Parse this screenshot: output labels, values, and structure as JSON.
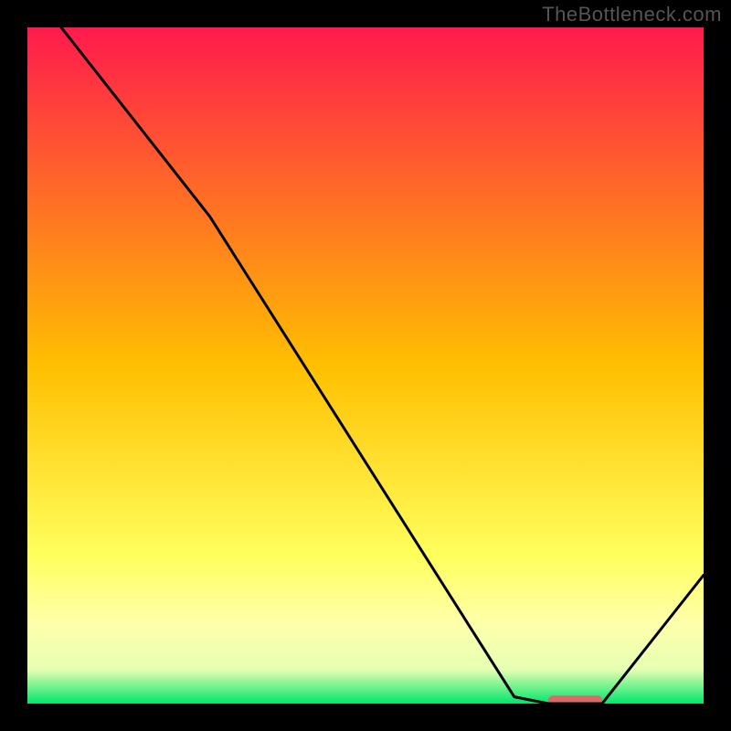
{
  "watermark": "TheBottleneck.com",
  "chart_data": {
    "type": "line",
    "title": "",
    "xlabel": "",
    "ylabel": "",
    "xlim": [
      0,
      100
    ],
    "ylim": [
      0,
      100
    ],
    "series": [
      {
        "name": "curve",
        "x": [
          5,
          27,
          72,
          77,
          85,
          100
        ],
        "y": [
          100,
          72,
          1,
          0,
          0,
          19
        ]
      }
    ],
    "marker": {
      "name": "optimal-zone",
      "x_start": 77,
      "x_end": 85,
      "y": 0.5,
      "color": "#d96a6a"
    },
    "gradient_stops": [
      {
        "offset": 0.0,
        "color": "#ff1a4d"
      },
      {
        "offset": 0.5,
        "color": "#ffbf00"
      },
      {
        "offset": 0.78,
        "color": "#ffff5c"
      },
      {
        "offset": 0.88,
        "color": "#ffffaa"
      },
      {
        "offset": 0.95,
        "color": "#e6ffb3"
      },
      {
        "offset": 1.0,
        "color": "#00e66a"
      }
    ]
  }
}
